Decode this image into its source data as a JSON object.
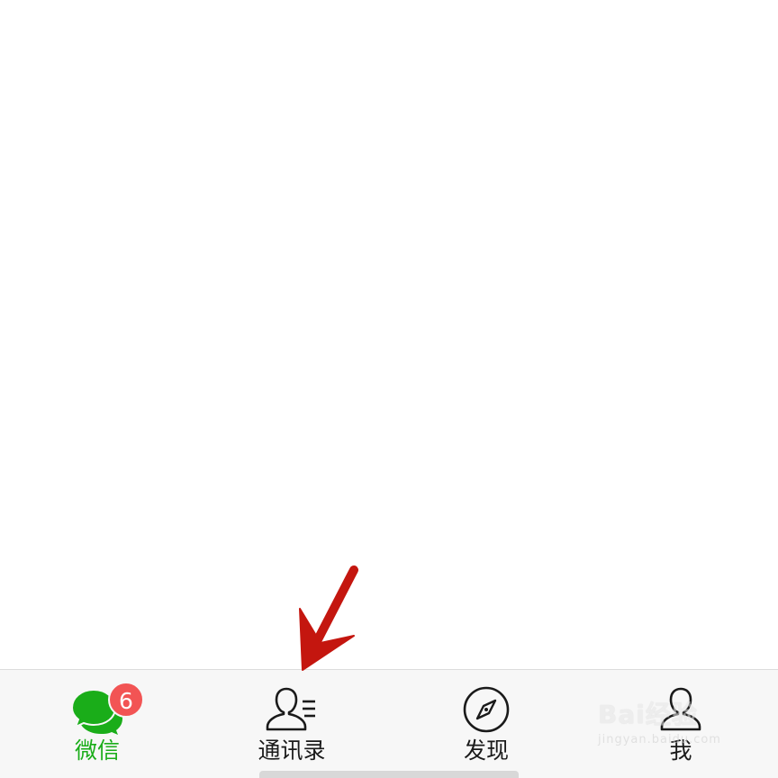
{
  "tabbar": {
    "tabs": [
      {
        "label": "微信",
        "icon": "chat-bubbles-icon",
        "active": true,
        "badge": "6"
      },
      {
        "label": "通讯录",
        "icon": "contacts-icon",
        "active": false
      },
      {
        "label": "发现",
        "icon": "compass-icon",
        "active": false
      },
      {
        "label": "我",
        "icon": "person-icon",
        "active": false
      }
    ]
  },
  "annotation": {
    "icon": "red-arrow-icon",
    "color": "#c4160f"
  },
  "watermark": {
    "logo": "Bai经验",
    "sub": "jingyan.baidu.com"
  },
  "colors": {
    "active": "#1aad19",
    "badge": "#f25454",
    "tabbar_bg": "#f7f7f7",
    "text": "#1a1a1a"
  }
}
